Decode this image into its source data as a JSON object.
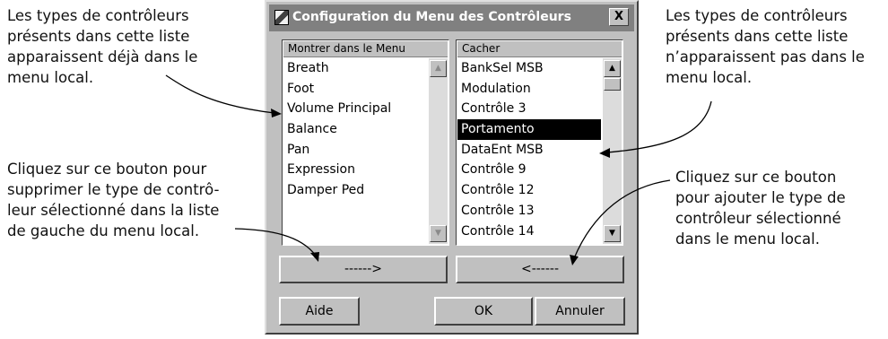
{
  "annotations": {
    "top_left": [
      "Les types de contrôleurs",
      "présents dans cette liste",
      "apparaissent déjà dans le",
      "menu local."
    ],
    "top_right": [
      "Les types de contrôleurs",
      "présents dans cette liste",
      "n’apparaissent pas dans le",
      "menu local."
    ],
    "bottom_left": [
      "Cliquez sur ce bouton pour",
      "supprimer le type de contrô-",
      "leur sélectionné dans la liste",
      "de gauche du menu local."
    ],
    "bottom_right": [
      "Cliquez sur ce bouton",
      "pour ajouter le type de",
      "contrôleur sélectionné",
      "dans le menu local."
    ]
  },
  "dialog": {
    "title": "Configuration du Menu des Contrôleurs",
    "close_label": "X",
    "show_list": {
      "header": "Montrer dans le Menu",
      "items": [
        "Breath",
        "Foot",
        "Volume Principal",
        "Balance",
        "Pan",
        "Expression",
        "Damper Ped"
      ]
    },
    "hide_list": {
      "header": "Cacher",
      "items": [
        "BankSel MSB",
        "Modulation",
        "Contrôle 3",
        "Portamento",
        "DataEnt MSB",
        "Contrôle 9",
        "Contrôle 12",
        "Contrôle 13",
        "Contrôle 14"
      ],
      "selected": "Portamento"
    },
    "move_right_label": "------>",
    "move_left_label": "<------",
    "help_label": "Aide",
    "ok_label": "OK",
    "cancel_label": "Annuler"
  },
  "icons": {
    "title_icon": "app-icon",
    "scroll_up": "arrow-up-icon",
    "scroll_down": "arrow-down-icon",
    "close": "close-icon"
  },
  "colors": {
    "dialog_face": "#c0c0c0",
    "titlebar": "#808080",
    "selection": "#000000"
  }
}
